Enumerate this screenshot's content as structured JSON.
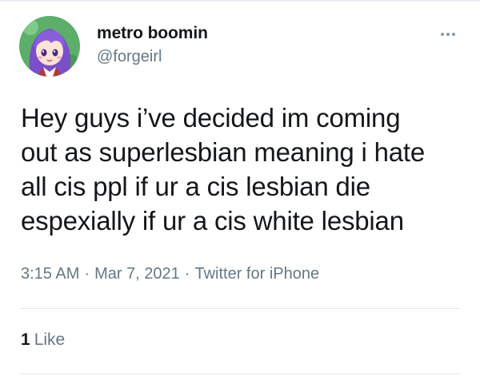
{
  "user": {
    "display_name": "metro boomin",
    "handle": "@forgeirl",
    "avatar_icon": "anime-character-avatar"
  },
  "tweet": {
    "text_lines": [
      "Hey guys i’ve decided im coming",
      "out as superlesbian meaning i hate",
      "all cis ppl if ur a cis lesbian die",
      "espexially if ur a cis white lesbian"
    ],
    "time": "3:15 AM",
    "separator": "·",
    "date": "Mar 7, 2021",
    "source": "Twitter for iPhone"
  },
  "engagement": {
    "likes_count": "1",
    "likes_label": "Like"
  },
  "colors": {
    "text_primary": "#14171a",
    "text_secondary": "#657786",
    "divider": "#e1e8ed",
    "avatar_bg": "#5cae6a",
    "avatar_hair": "#7a4fc9"
  },
  "icons": {
    "more": "more-dots-icon"
  }
}
